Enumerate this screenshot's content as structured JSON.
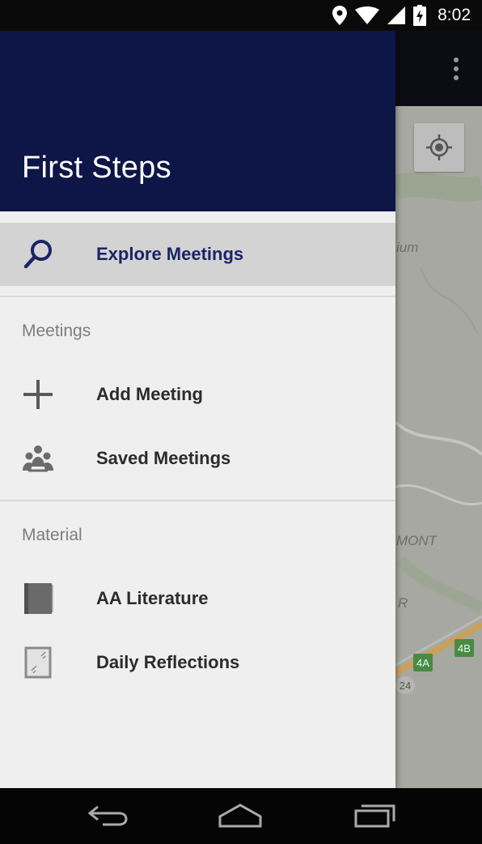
{
  "status_bar": {
    "time": "8:02",
    "icons": [
      "location-icon",
      "wifi-icon",
      "signal-icon",
      "battery-charging-icon"
    ]
  },
  "toolbar": {
    "overflow_icon": "more-vert-icon"
  },
  "map": {
    "labels": [
      "ium",
      "MONT",
      "R"
    ],
    "badges": [
      "4A",
      "4B",
      "24"
    ],
    "locate_icon": "my-location-icon"
  },
  "drawer": {
    "title": "First Steps",
    "header_color": "#0e1547",
    "accent_color": "#1b2466",
    "explore": {
      "label": "Explore Meetings",
      "icon": "search-icon"
    },
    "sections": [
      {
        "title": "Meetings",
        "items": [
          {
            "label": "Add Meeting",
            "icon": "plus-icon"
          },
          {
            "label": "Saved Meetings",
            "icon": "group-icon"
          }
        ]
      },
      {
        "title": "Material",
        "items": [
          {
            "label": "AA Literature",
            "icon": "book-icon"
          },
          {
            "label": "Daily Reflections",
            "icon": "mirror-icon"
          }
        ]
      }
    ]
  },
  "nav_bar": {
    "buttons": [
      "back-icon",
      "home-icon",
      "recents-icon"
    ]
  }
}
